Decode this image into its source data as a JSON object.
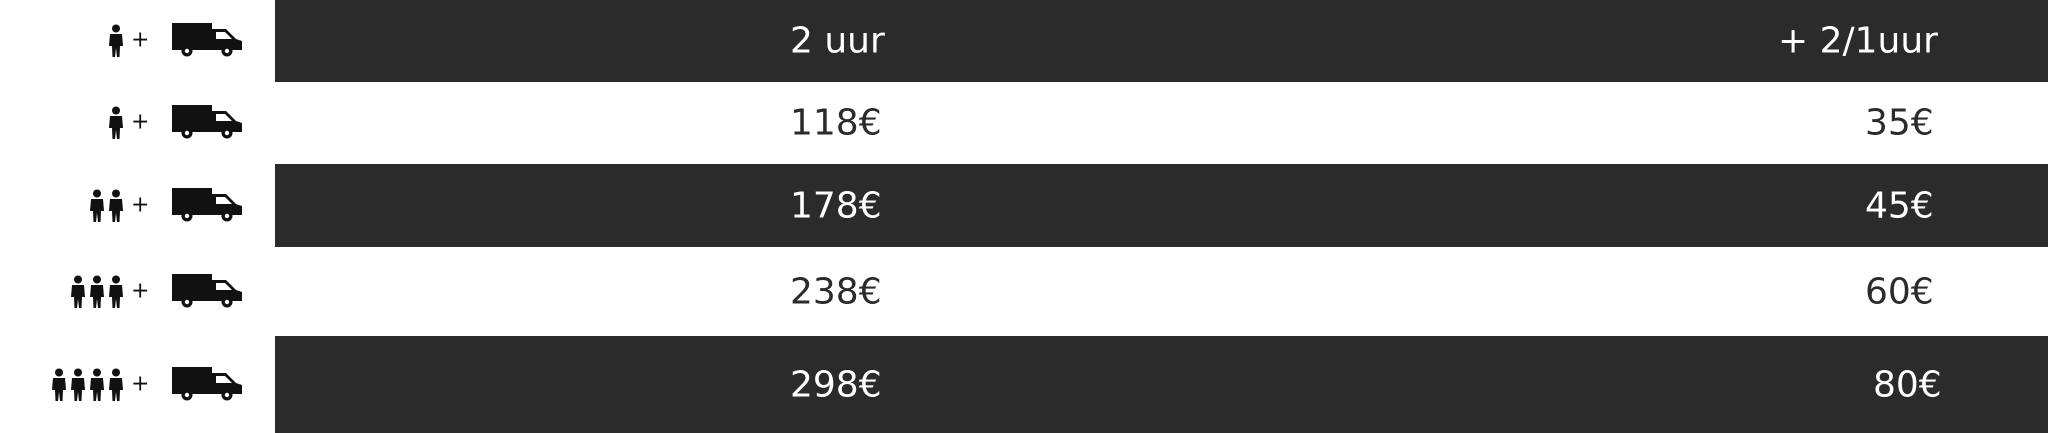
{
  "header": {
    "col_a": "2 uur",
    "col_b": "+ 2/1uur",
    "plus": "+"
  },
  "rows": [
    {
      "persons": 1,
      "plus": "+",
      "price_2h": "118€",
      "price_extra": "35€"
    },
    {
      "persons": 2,
      "plus": "+",
      "price_2h": "178€",
      "price_extra": "45€"
    },
    {
      "persons": 3,
      "plus": "+",
      "price_2h": "238€",
      "price_extra": "60€"
    },
    {
      "persons": 4,
      "plus": "+",
      "price_2h": "298€",
      "price_extra": "80€"
    }
  ],
  "icons": {
    "person": "person-icon",
    "truck": "truck-icon"
  },
  "colors": {
    "dark_band": "#2b2b2b",
    "light_band": "#ffffff",
    "dark_text": "#ffffff",
    "light_text": "#2b2b2b",
    "icon": "#111111"
  }
}
